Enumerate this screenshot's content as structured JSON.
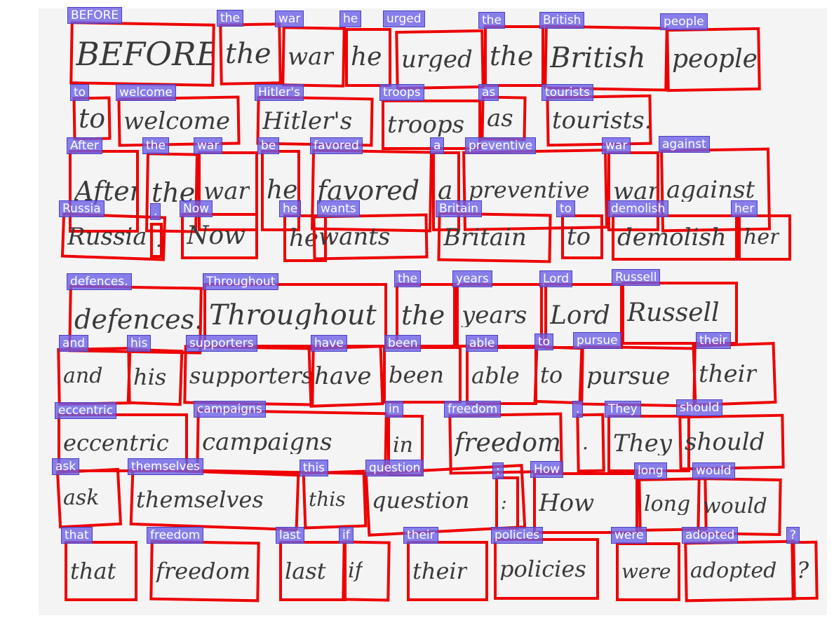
{
  "words": [
    "BEFORE",
    "the",
    "war",
    "he",
    "urged",
    "the",
    "British",
    "people",
    "to",
    "welcome",
    "Hitler's",
    "troops",
    "as",
    "tourists",
    "After",
    "the",
    "war",
    "be",
    "favored",
    "a",
    "preventive",
    "war",
    "against",
    "Russia",
    ".",
    "Now",
    "he",
    "wants",
    "Britain",
    "to",
    "demolish",
    "her",
    "defences.",
    "Throughout",
    "the",
    "years",
    "Lord",
    "Russell",
    "and",
    "his",
    "supporters",
    "have",
    "been",
    "able",
    "to",
    "pursue",
    "their",
    "eccentric",
    "campaigns",
    "in",
    "freedom",
    ".",
    "They",
    "should",
    "ask",
    "themselves",
    "this",
    "question",
    ":",
    "How",
    "long",
    "would",
    "that",
    "freedom",
    "last",
    "if",
    "their",
    "policies",
    "were",
    "adopted",
    "?"
  ],
  "handwriting": [
    "BEFORE",
    "the",
    "war",
    "he",
    "urged",
    "the",
    "British",
    "people",
    "to",
    "welcome",
    "Hitler's",
    "troops",
    "as",
    "tourists.",
    "After",
    "the",
    "war",
    "he",
    "favored",
    "a",
    "preventive",
    "war",
    "against",
    "Russia",
    ".",
    "Now",
    "he",
    "wants",
    "Britain",
    "to",
    "demolish",
    "her",
    "defences.",
    "Throughout",
    "the",
    "years",
    "Lord",
    "Russell",
    "and",
    "his",
    "supporters",
    "have",
    "been",
    "able",
    "to",
    "pursue",
    "their",
    "eccentric",
    "campaigns",
    "in",
    "freedom",
    ".",
    "They",
    "should",
    "ask",
    "themselves",
    "this",
    "question",
    ":",
    "How",
    "long",
    "would",
    "that",
    "freedom",
    "last",
    "if",
    "their",
    "policies",
    "were",
    "adopted",
    "?"
  ],
  "colors": {
    "box": "#ee0000",
    "label_bg": "#6c60e8",
    "label_text": "#ffffff",
    "ink": "#3a3a3a"
  }
}
